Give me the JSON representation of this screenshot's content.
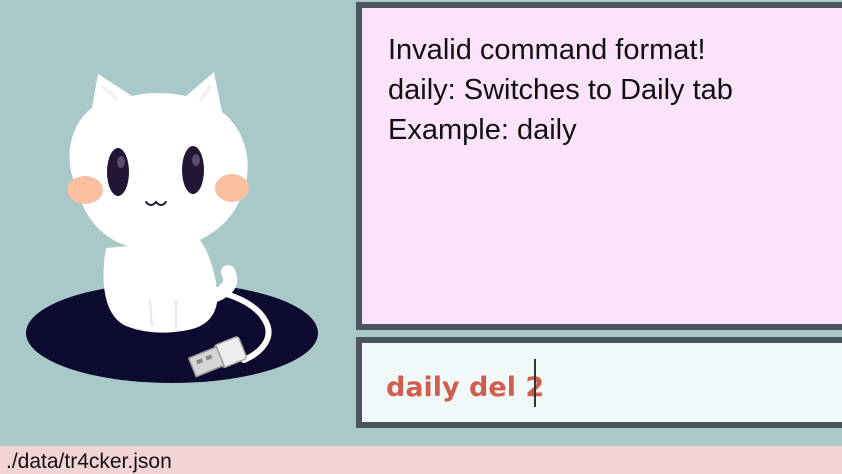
{
  "response": {
    "lines": [
      "Invalid command format!",
      "daily: Switches to Daily tab",
      "Example: daily"
    ]
  },
  "command": {
    "value": "daily del 2"
  },
  "status_bar": {
    "file_path": "./data/tr4cker.json"
  },
  "colors": {
    "background": "#a9c8c9",
    "response_background": "#fbe4fb",
    "command_background": "#f1f8fa",
    "border": "#4a5560",
    "command_text": "#cf5f4c",
    "status_background": "#f2d3d6"
  },
  "mascot": {
    "icon": "cat-with-usb-cable-icon"
  }
}
